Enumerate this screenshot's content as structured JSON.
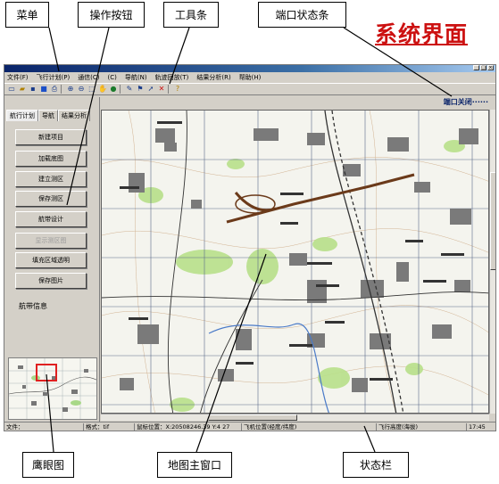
{
  "callouts": {
    "menu": "菜单",
    "buttons": "操作按钮",
    "toolbar": "工具条",
    "port_status_bar": "端口状态条",
    "overview": "鹰眼图",
    "map_main": "地图主窗口",
    "status_bar": "状态栏"
  },
  "page_title": "系统界面",
  "app": {
    "menu": [
      "文件(F)",
      "飞行计划(P)",
      "通信(C)",
      "(C)",
      "导航(N)",
      "轨迹回放(T)",
      "结果分析(R)",
      "帮助(H)"
    ],
    "toolbar_icons": [
      "new-icon",
      "open-icon",
      "save-icon",
      "save-blue-icon",
      "print-icon",
      "zoom-in-icon",
      "zoom-out-icon",
      "zoom-box-icon",
      "pan-hand-icon",
      "globe-icon",
      "pen-icon",
      "flag-icon",
      "pointer-icon",
      "delete-icon",
      "help-icon"
    ],
    "port_status": "端口关闭······",
    "tabs": [
      "航行计划",
      "导航",
      "结果分析"
    ],
    "buttons": [
      "新建项目",
      "加载底图",
      "建立测区",
      "保存测区",
      "航带设计",
      "显示测区图",
      "填充区域透明",
      "保存图片"
    ],
    "disabled_button_index": 5,
    "route_info_label": "航带信息",
    "statusbar": {
      "file": "文件：",
      "format": "格式：tif",
      "coords": "鼠标位置：X:20508246.39 Y:4 27",
      "plane_pos": "飞机位置(经度/纬度)",
      "altitude": "飞行高度(海拔)",
      "time": "17:45"
    }
  },
  "colors": {
    "title_red": "#cc1111",
    "window_face": "#d4d0c8",
    "map_bg": "#f4f4ee",
    "map_green": "#b8e08a",
    "map_building": "#6e6e6e",
    "route_brown": "#6b3a1a"
  }
}
